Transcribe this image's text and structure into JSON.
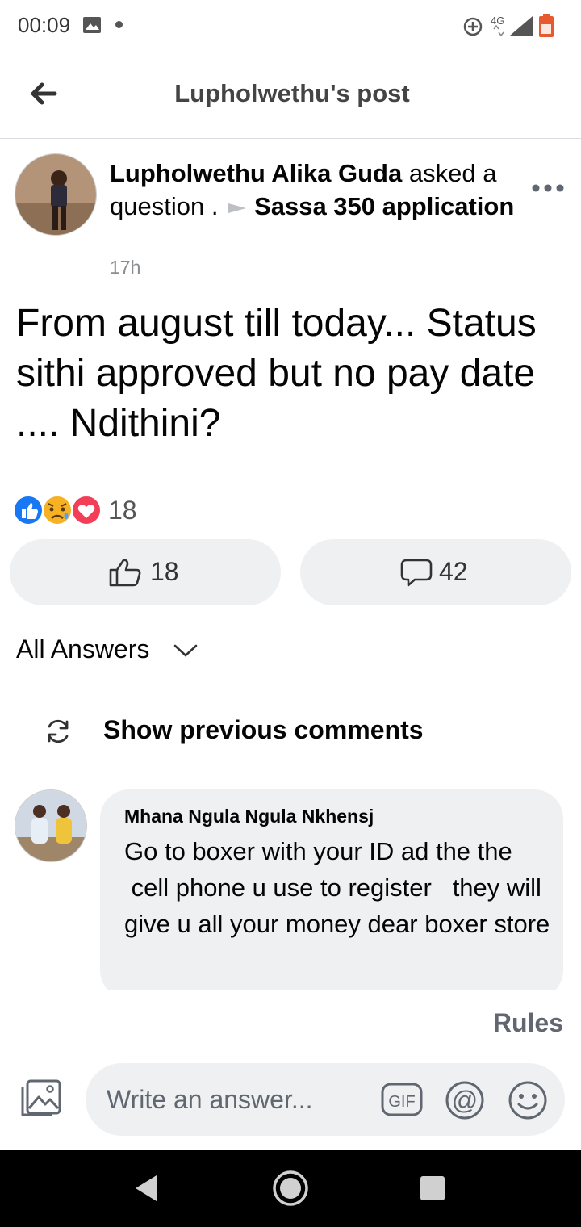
{
  "status_bar": {
    "time": "00:09",
    "network": "4G",
    "icons": [
      "image-icon",
      "dot-icon",
      "data-saver-icon",
      "signal-icon",
      "battery-icon"
    ]
  },
  "app_bar": {
    "title": "Lupholwethu's post",
    "back_icon": "arrow-left-icon"
  },
  "post": {
    "author": "Lupholwethu Alika Guda",
    "action": " asked a question . ",
    "group": "Sassa 350 application",
    "time": "17h",
    "body": "From august till today... Status sithi approved but no pay date .... Ndithini?",
    "reactions": {
      "types": [
        "like",
        "sad",
        "love"
      ],
      "count": "18"
    },
    "like_count": "18",
    "comment_count": "42"
  },
  "answers": {
    "filter_label": "All Answers",
    "show_previous_label": "Show previous comments"
  },
  "comment": {
    "author": "Mhana Ngula Ngula Nkhensj",
    "text": "Go to boxer with your ID ad the the\n cell phone u use to register   they will give u all your money dear boxer store"
  },
  "composer": {
    "rules_label": "Rules",
    "placeholder": "Write an answer..."
  },
  "colors": {
    "like_blue": "#1877f2",
    "love_red": "#f33e58",
    "sad_yellow": "#f7b125",
    "pill_bg": "#eff0f2",
    "secondary_text": "#8a8d91"
  }
}
